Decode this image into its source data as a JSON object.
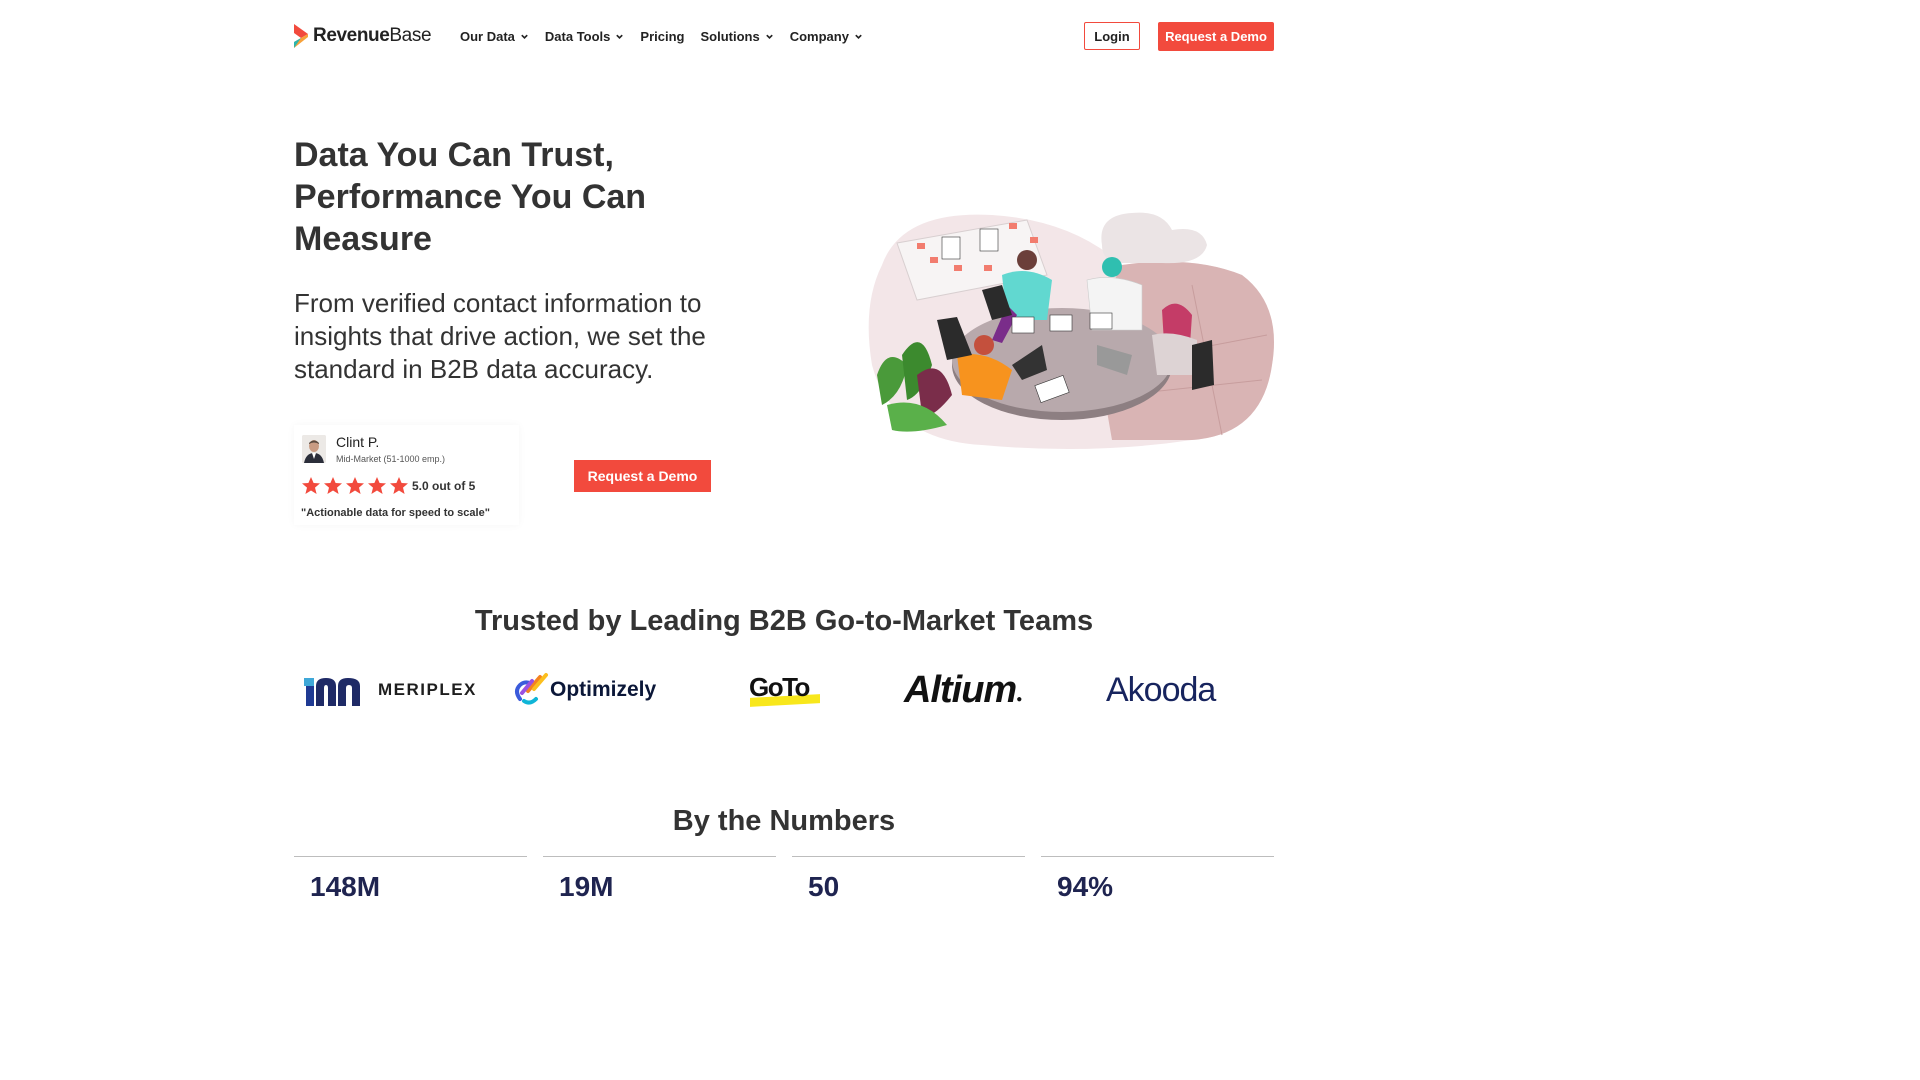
{
  "brand": {
    "logo_text_bold": "Revenue",
    "logo_text_light": "Base",
    "accent": "#f24a3d"
  },
  "nav": {
    "items": [
      {
        "label": "Our Data",
        "dropdown": true
      },
      {
        "label": "Data Tools",
        "dropdown": true
      },
      {
        "label": "Pricing",
        "dropdown": false
      },
      {
        "label": "Solutions",
        "dropdown": true
      },
      {
        "label": "Company",
        "dropdown": true
      }
    ],
    "login_label": "Login",
    "demo_label": "Request a Demo"
  },
  "hero": {
    "title": "Data You Can Trust, Performance You Can Measure",
    "subtitle": "From verified contact information to insights that drive action, we set the standard in B2B data accuracy.",
    "cta_label": "Request a Demo",
    "review": {
      "name": "Clint P.",
      "segment": "Mid-Market (51-1000 emp.)",
      "stars": 5,
      "rating_text": "5.0 out of 5",
      "quote": "\"Actionable data for speed to scale\""
    }
  },
  "trusted": {
    "title": "Trusted by Leading B2B Go-to-Market Teams",
    "logos": [
      {
        "name": "MERIPLEX",
        "icon": "meriplex-logo"
      },
      {
        "name": "Optimizely",
        "icon": "optimizely-logo"
      },
      {
        "name": "GoTo",
        "icon": "goto-logo"
      },
      {
        "name": "Altium",
        "icon": "altium-logo"
      },
      {
        "name": "Akooda",
        "icon": "akooda-logo"
      }
    ]
  },
  "numbers": {
    "title": "By the Numbers",
    "stats": [
      "148M",
      "19M",
      "50",
      "94%"
    ]
  }
}
